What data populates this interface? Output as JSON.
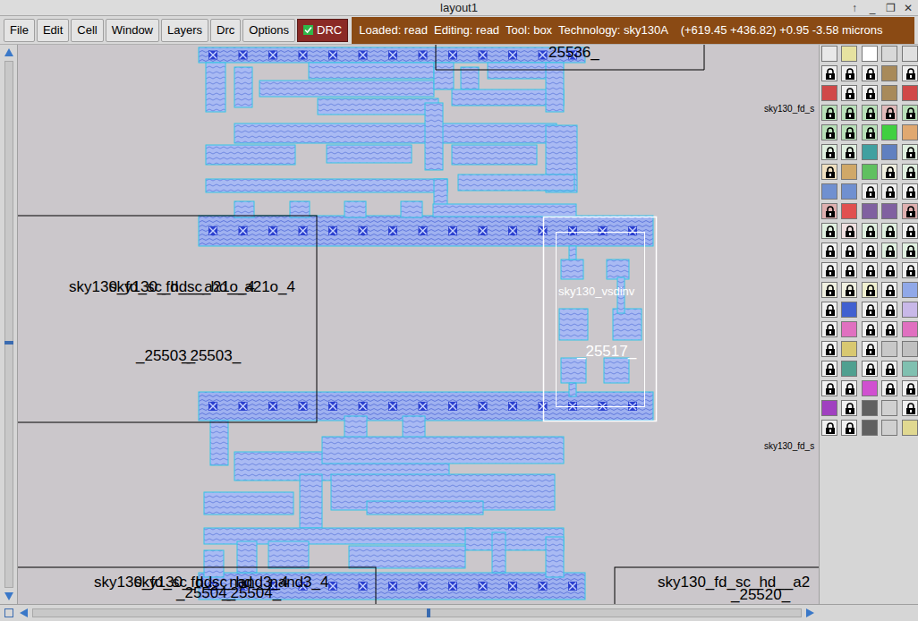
{
  "window": {
    "title": "layout1",
    "controls": [
      "↑",
      "_",
      "❐",
      "✕"
    ]
  },
  "menu": [
    "File",
    "Edit",
    "Cell",
    "Window",
    "Layers",
    "Drc",
    "Options"
  ],
  "drc_toggle": {
    "label": "DRC",
    "checked": true
  },
  "status": "Loaded: read  Editing: read  Tool: box  Technology: sky130A    (+619.45 +436.82) +0.95 -3.58 microns",
  "labels": [
    {
      "text": "sky130_fd_sc_hd__a21o_4",
      "color": "#000000"
    },
    {
      "text": "sky130_fd_sc_hd__a21o_4",
      "color": "#000000"
    },
    {
      "text": "_25503_",
      "color": "#000000"
    },
    {
      "text": "_25503_",
      "color": "#000000"
    },
    {
      "text": "sky130_vsdinv",
      "color": "#ffffff"
    },
    {
      "text": "_25517_",
      "color": "#ffffff"
    },
    {
      "text": "25536_",
      "color": "#000000"
    },
    {
      "text": "sky130_fd_sc_hd__nand3_4",
      "color": "#000000"
    },
    {
      "text": "sky130_fd_sc_hd__nand3_4",
      "color": "#000000"
    },
    {
      "text": "_25504_",
      "color": "#000000"
    },
    {
      "text": "_25504_",
      "color": "#000000"
    },
    {
      "text": "sky130_fd_sc_hd__a2",
      "color": "#000000"
    },
    {
      "text": "_25520_",
      "color": "#000000"
    },
    {
      "text": "sky130_fd_s",
      "color": "#000000"
    },
    {
      "text": "sky130_fd_s",
      "color": "#000000"
    }
  ],
  "palette": [
    {
      "color": "#e8e8e8",
      "locked": false
    },
    {
      "color": "#e6e2a0",
      "locked": false
    },
    {
      "color": "#ffffff",
      "locked": false
    },
    {
      "color": "#d8d8d8",
      "locked": false
    },
    {
      "color": "#e0e0e0",
      "locked": false
    },
    {
      "color": "#f0f0f0",
      "locked": true
    },
    {
      "color": "#f0f0f0",
      "locked": true
    },
    {
      "color": "#f0f0f0",
      "locked": true
    },
    {
      "color": "#a88a5a",
      "locked": false
    },
    {
      "color": "#f0f0f0",
      "locked": true
    },
    {
      "color": "#d04848",
      "locked": false
    },
    {
      "color": "#f0f0f0",
      "locked": true
    },
    {
      "color": "#f0f0f0",
      "locked": true
    },
    {
      "color": "#a88a5a",
      "locked": false
    },
    {
      "color": "#d04848",
      "locked": false
    },
    {
      "color": "#b8e0b8",
      "locked": true
    },
    {
      "color": "#b8e0b8",
      "locked": true
    },
    {
      "color": "#b8e0b8",
      "locked": true
    },
    {
      "color": "#e0b8b8",
      "locked": true
    },
    {
      "color": "#b8e0b8",
      "locked": true
    },
    {
      "color": "#b8e0b8",
      "locked": true
    },
    {
      "color": "#b8e0b8",
      "locked": true
    },
    {
      "color": "#b8e0b8",
      "locked": true
    },
    {
      "color": "#40d040",
      "locked": false
    },
    {
      "color": "#e0a870",
      "locked": false
    },
    {
      "color": "#e0f0e0",
      "locked": true
    },
    {
      "color": "#e0f0e0",
      "locked": true
    },
    {
      "color": "#40a0a0",
      "locked": false
    },
    {
      "color": "#6080c0",
      "locked": false
    },
    {
      "color": "#e0f0e0",
      "locked": true
    },
    {
      "color": "#f0e0c0",
      "locked": true
    },
    {
      "color": "#d0a868",
      "locked": false
    },
    {
      "color": "#60c060",
      "locked": false
    },
    {
      "color": "#f0f0e0",
      "locked": true
    },
    {
      "color": "#e0f0e0",
      "locked": true
    },
    {
      "color": "#7090d0",
      "locked": false
    },
    {
      "color": "#7090d0",
      "locked": false
    },
    {
      "color": "#f0f0f0",
      "locked": true
    },
    {
      "color": "#f0f0f0",
      "locked": true
    },
    {
      "color": "#f0f0f0",
      "locked": true
    },
    {
      "color": "#e0b0b0",
      "locked": true
    },
    {
      "color": "#e05050",
      "locked": false
    },
    {
      "color": "#8060a0",
      "locked": false
    },
    {
      "color": "#8060a0",
      "locked": false
    },
    {
      "color": "#e0b0b0",
      "locked": true
    },
    {
      "color": "#e0f0e0",
      "locked": true
    },
    {
      "color": "#f0e0e0",
      "locked": true
    },
    {
      "color": "#e0f0e0",
      "locked": true
    },
    {
      "color": "#e0f0e0",
      "locked": true
    },
    {
      "color": "#f0f0f0",
      "locked": true
    },
    {
      "color": "#f0f0f0",
      "locked": true
    },
    {
      "color": "#f0f0f0",
      "locked": true
    },
    {
      "color": "#f0f0f0",
      "locked": true
    },
    {
      "color": "#e0f0e0",
      "locked": true
    },
    {
      "color": "#e0f0e0",
      "locked": true
    },
    {
      "color": "#f0f0f0",
      "locked": true
    },
    {
      "color": "#f0f0f0",
      "locked": true
    },
    {
      "color": "#f0f0f0",
      "locked": true
    },
    {
      "color": "#f0f0f0",
      "locked": true
    },
    {
      "color": "#f0f0f0",
      "locked": true
    },
    {
      "color": "#f0f0e0",
      "locked": true
    },
    {
      "color": "#f0f0e0",
      "locked": true
    },
    {
      "color": "#f0f0d0",
      "locked": true
    },
    {
      "color": "#f0f0f0",
      "locked": true
    },
    {
      "color": "#90a8e8",
      "locked": false
    },
    {
      "color": "#f0f0f0",
      "locked": true
    },
    {
      "color": "#4060d0",
      "locked": false
    },
    {
      "color": "#f0f0f0",
      "locked": true
    },
    {
      "color": "#f0f0f0",
      "locked": true
    },
    {
      "color": "#c8b8e8",
      "locked": false
    },
    {
      "color": "#f0f0f0",
      "locked": true
    },
    {
      "color": "#e070c0",
      "locked": false
    },
    {
      "color": "#f0f0f0",
      "locked": true
    },
    {
      "color": "#f0f0f0",
      "locked": true
    },
    {
      "color": "#e070c0",
      "locked": false
    },
    {
      "color": "#f0f0f0",
      "locked": true
    },
    {
      "color": "#d8c870",
      "locked": false
    },
    {
      "color": "#f0f0f0",
      "locked": true
    },
    {
      "color": "#c8c8c8",
      "locked": false
    },
    {
      "color": "#c0c0c0",
      "locked": false
    },
    {
      "color": "#f0f0f0",
      "locked": true
    },
    {
      "color": "#50a090",
      "locked": false
    },
    {
      "color": "#f0f0f0",
      "locked": true
    },
    {
      "color": "#f0f0f0",
      "locked": true
    },
    {
      "color": "#80c0b0",
      "locked": false
    },
    {
      "color": "#f0f0f0",
      "locked": true
    },
    {
      "color": "#f0f0f0",
      "locked": true
    },
    {
      "color": "#d050d0",
      "locked": false
    },
    {
      "color": "#f0f0f0",
      "locked": true
    },
    {
      "color": "#f0f0f0",
      "locked": true
    },
    {
      "color": "#a040c0",
      "locked": false
    },
    {
      "color": "#f0f0f0",
      "locked": true
    },
    {
      "color": "#606060",
      "locked": false
    },
    {
      "color": "#d0d0d0",
      "locked": false
    },
    {
      "color": "#f0f0f0",
      "locked": true
    },
    {
      "color": "#f0f0f0",
      "locked": true
    },
    {
      "color": "#f0f0f0",
      "locked": true
    },
    {
      "color": "#606060",
      "locked": false
    },
    {
      "color": "#d0d0d0",
      "locked": false
    },
    {
      "color": "#e0d890",
      "locked": false
    }
  ]
}
